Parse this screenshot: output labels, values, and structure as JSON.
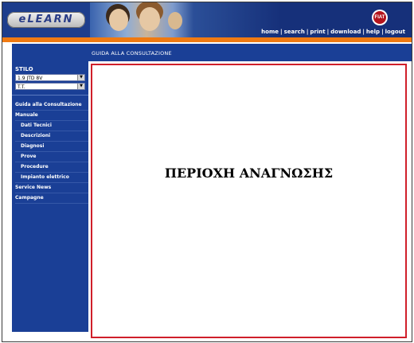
{
  "header": {
    "logo_text": "eLEARN",
    "brand_badge": "FIAT",
    "nav": [
      {
        "label": "home"
      },
      {
        "label": "search"
      },
      {
        "label": "print"
      },
      {
        "label": "download"
      },
      {
        "label": "help"
      },
      {
        "label": "logout"
      }
    ]
  },
  "sidebar": {
    "model": "STILO",
    "engine_select": {
      "value": "1.9 JTD 8V"
    },
    "variant_select": {
      "value": "T.T."
    },
    "menu": [
      {
        "label": "Guida alla Consultazione",
        "level": 0
      },
      {
        "label": "Manuale",
        "level": 0
      },
      {
        "label": "Dati Tecnici",
        "level": 1
      },
      {
        "label": "Descrizioni",
        "level": 1
      },
      {
        "label": "Diagnosi",
        "level": 1
      },
      {
        "label": "Prove",
        "level": 1
      },
      {
        "label": "Procedure",
        "level": 1
      },
      {
        "label": "Impianto elettrico",
        "level": 1
      },
      {
        "label": "Service News",
        "level": 0
      },
      {
        "label": "Campagne",
        "level": 0
      }
    ]
  },
  "main": {
    "breadcrumb": "GUIDA ALLA CONSULTAZIONE",
    "reading_area_text": "ΠΕΡΙΟΧΗ ΑΝΑΓΝΩΣΗΣ"
  },
  "colors": {
    "navy": "#1a3f96",
    "orange": "#f07a12",
    "reading_border": "#d01f2a"
  }
}
